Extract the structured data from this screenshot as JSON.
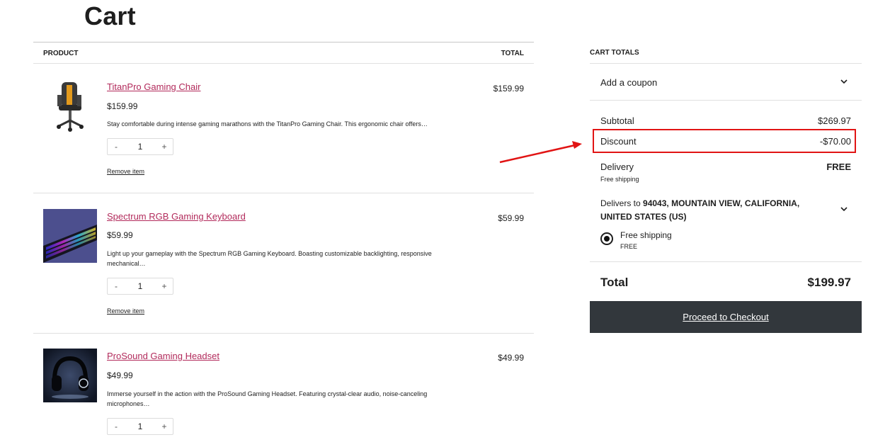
{
  "page": {
    "title": "Cart"
  },
  "table": {
    "headers": {
      "product": "PRODUCT",
      "total": "TOTAL"
    },
    "items": [
      {
        "name": "TitanPro Gaming Chair",
        "price": "$159.99",
        "description": "Stay comfortable during intense gaming marathons with the TitanPro Gaming Chair. This ergonomic chair offers…",
        "quantity": "1",
        "remove_label": "Remove item",
        "total": "$159.99",
        "image_icon": "gaming-chair-image"
      },
      {
        "name": "Spectrum RGB Gaming Keyboard",
        "price": "$59.99",
        "description": "Light up your gameplay with the Spectrum RGB Gaming Keyboard. Boasting customizable backlighting, responsive mechanical…",
        "quantity": "1",
        "remove_label": "Remove item",
        "total": "$59.99",
        "image_icon": "rgb-keyboard-image"
      },
      {
        "name": "ProSound Gaming Headset",
        "price": "$49.99",
        "description": "Immerse yourself in the action with the ProSound Gaming Headset. Featuring crystal-clear audio, noise-canceling microphones…",
        "quantity": "1",
        "total": "$49.99",
        "image_icon": "gaming-headset-image"
      }
    ],
    "qty_minus": "-",
    "qty_plus": "+"
  },
  "totals": {
    "heading": "CART TOTALS",
    "coupon_label": "Add a coupon",
    "subtotal_label": "Subtotal",
    "subtotal_value": "$269.97",
    "discount_label": "Discount",
    "discount_value": "-$70.00",
    "delivery_label": "Delivery",
    "delivery_sub": "Free shipping",
    "delivery_value": "FREE",
    "delivers_prefix": "Delivers to",
    "delivers_address": "94043, MOUNTAIN VIEW, CALIFORNIA, UNITED STATES (US)",
    "shipping_option_label": "Free shipping",
    "shipping_option_sub": "FREE",
    "total_label": "Total",
    "total_value": "$199.97",
    "checkout_label": "Proceed to Checkout"
  },
  "colors": {
    "product_link": "#b22a5b",
    "highlight": "#e11414",
    "checkout_bg": "#32373c"
  }
}
